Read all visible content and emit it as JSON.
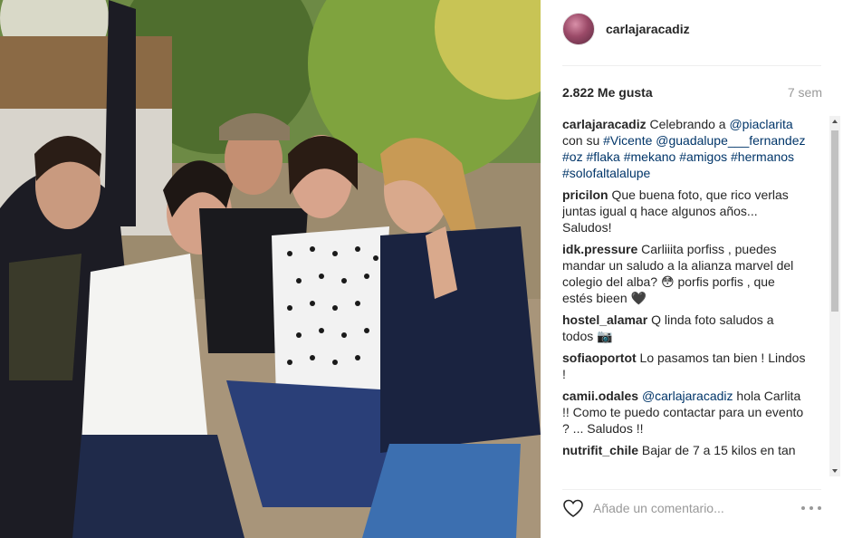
{
  "post": {
    "username": "carlajaracadiz",
    "likes": "2.822 Me gusta",
    "age": "7 sem"
  },
  "comments": [
    {
      "user": "carlajaracadiz",
      "parts": [
        {
          "t": "Celebrando a ",
          "link": false
        },
        {
          "t": "@piaclarita",
          "link": true
        },
        {
          "t": " con su ",
          "link": false
        },
        {
          "t": "#Vicente",
          "link": true
        },
        {
          "t": " ",
          "link": false
        },
        {
          "t": "@guadalupe___fernandez",
          "link": true
        },
        {
          "t": " ",
          "link": false
        },
        {
          "t": "#oz",
          "link": true
        },
        {
          "t": " ",
          "link": false
        },
        {
          "t": "#flaka",
          "link": true
        },
        {
          "t": " ",
          "link": false
        },
        {
          "t": "#mekano",
          "link": true
        },
        {
          "t": " ",
          "link": false
        },
        {
          "t": "#amigos",
          "link": true
        },
        {
          "t": " ",
          "link": false
        },
        {
          "t": "#hermanos",
          "link": true
        },
        {
          "t": " ",
          "link": false
        },
        {
          "t": "#solofaltalalupe",
          "link": true
        }
      ]
    },
    {
      "user": "pricilon",
      "parts": [
        {
          "t": "Que buena foto, que rico verlas juntas igual q hace algunos años... Saludos!",
          "link": false
        }
      ]
    },
    {
      "user": "idk.pressure",
      "parts": [
        {
          "t": "Carliiita porfiss , puedes mandar un saludo a la alianza marvel del colegio del alba? 😳 porfis porfis , que estés bieen 🖤",
          "link": false
        }
      ]
    },
    {
      "user": "hostel_alamar",
      "parts": [
        {
          "t": "Q linda foto saludos a todos 📷",
          "link": false
        }
      ]
    },
    {
      "user": "sofiaoportot",
      "parts": [
        {
          "t": "Lo pasamos tan bien ! Lindos !",
          "link": false
        }
      ]
    },
    {
      "user": "camii.odales",
      "parts": [
        {
          "t": "@carlajaracadiz",
          "link": true
        },
        {
          "t": " hola Carlita !! Como te puedo contactar para un evento ? ... Saludos !!",
          "link": false
        }
      ]
    },
    {
      "user": "nutrifit_chile",
      "parts": [
        {
          "t": "Bajar de 7 a 15 kilos en tan",
          "link": false
        }
      ]
    }
  ],
  "footer": {
    "comment_placeholder": "Añade un comentario...",
    "like_icon": "heart-outline-icon",
    "more_icon": "ellipsis-icon"
  },
  "colors": {
    "link": "#003569",
    "text": "#262626",
    "muted": "#999999"
  }
}
